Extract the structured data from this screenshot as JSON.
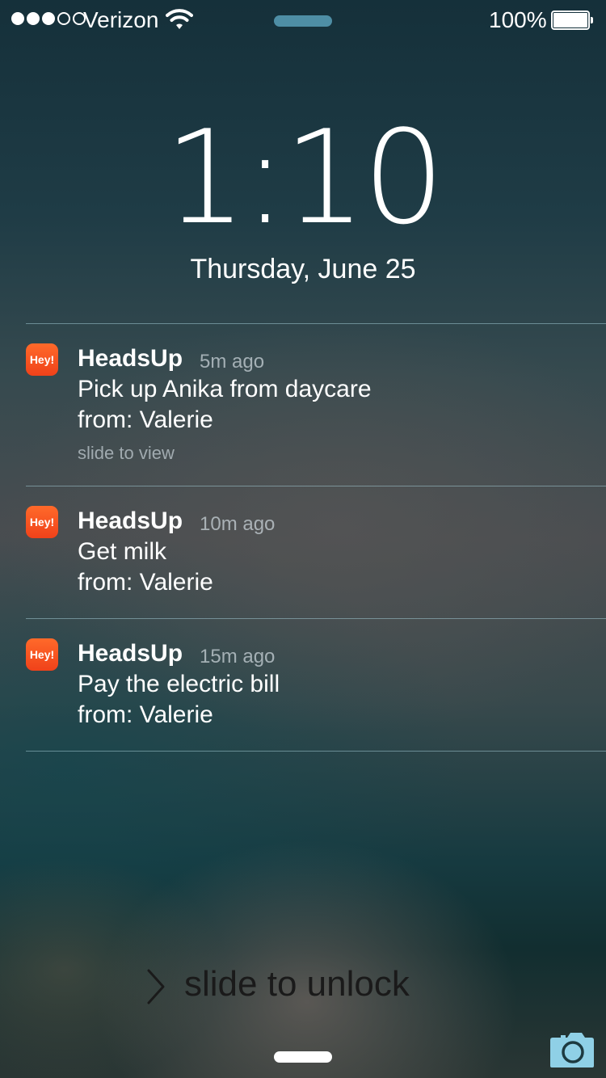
{
  "status_bar": {
    "signal_bars_total": 5,
    "signal_bars_filled": 3,
    "carrier": "Verizon",
    "battery_percent_label": "100%",
    "battery_level": 1.0
  },
  "lock_screen": {
    "time": "1:10",
    "date": "Thursday, June 25"
  },
  "notifications": [
    {
      "app_icon_text": "Hey!",
      "app_name": "HeadsUp",
      "time_ago": "5m ago",
      "message": "Pick up Anika from daycare",
      "from": "from: Valerie",
      "action_hint": "slide to view"
    },
    {
      "app_icon_text": "Hey!",
      "app_name": "HeadsUp",
      "time_ago": "10m ago",
      "message": "Get milk",
      "from": "from: Valerie"
    },
    {
      "app_icon_text": "Hey!",
      "app_name": "HeadsUp",
      "time_ago": "15m ago",
      "message": "Pay the electric bill",
      "from": "from: Valerie"
    }
  ],
  "unlock": {
    "label": "slide to unlock"
  },
  "icons": {
    "wifi": "wifi-icon",
    "battery": "battery-icon",
    "camera": "camera-icon",
    "chevron": "chevron-right-icon"
  },
  "colors": {
    "app_icon": "#f0421a",
    "grabber_top": "#4e8ea5",
    "camera": "#8fd0e6"
  }
}
